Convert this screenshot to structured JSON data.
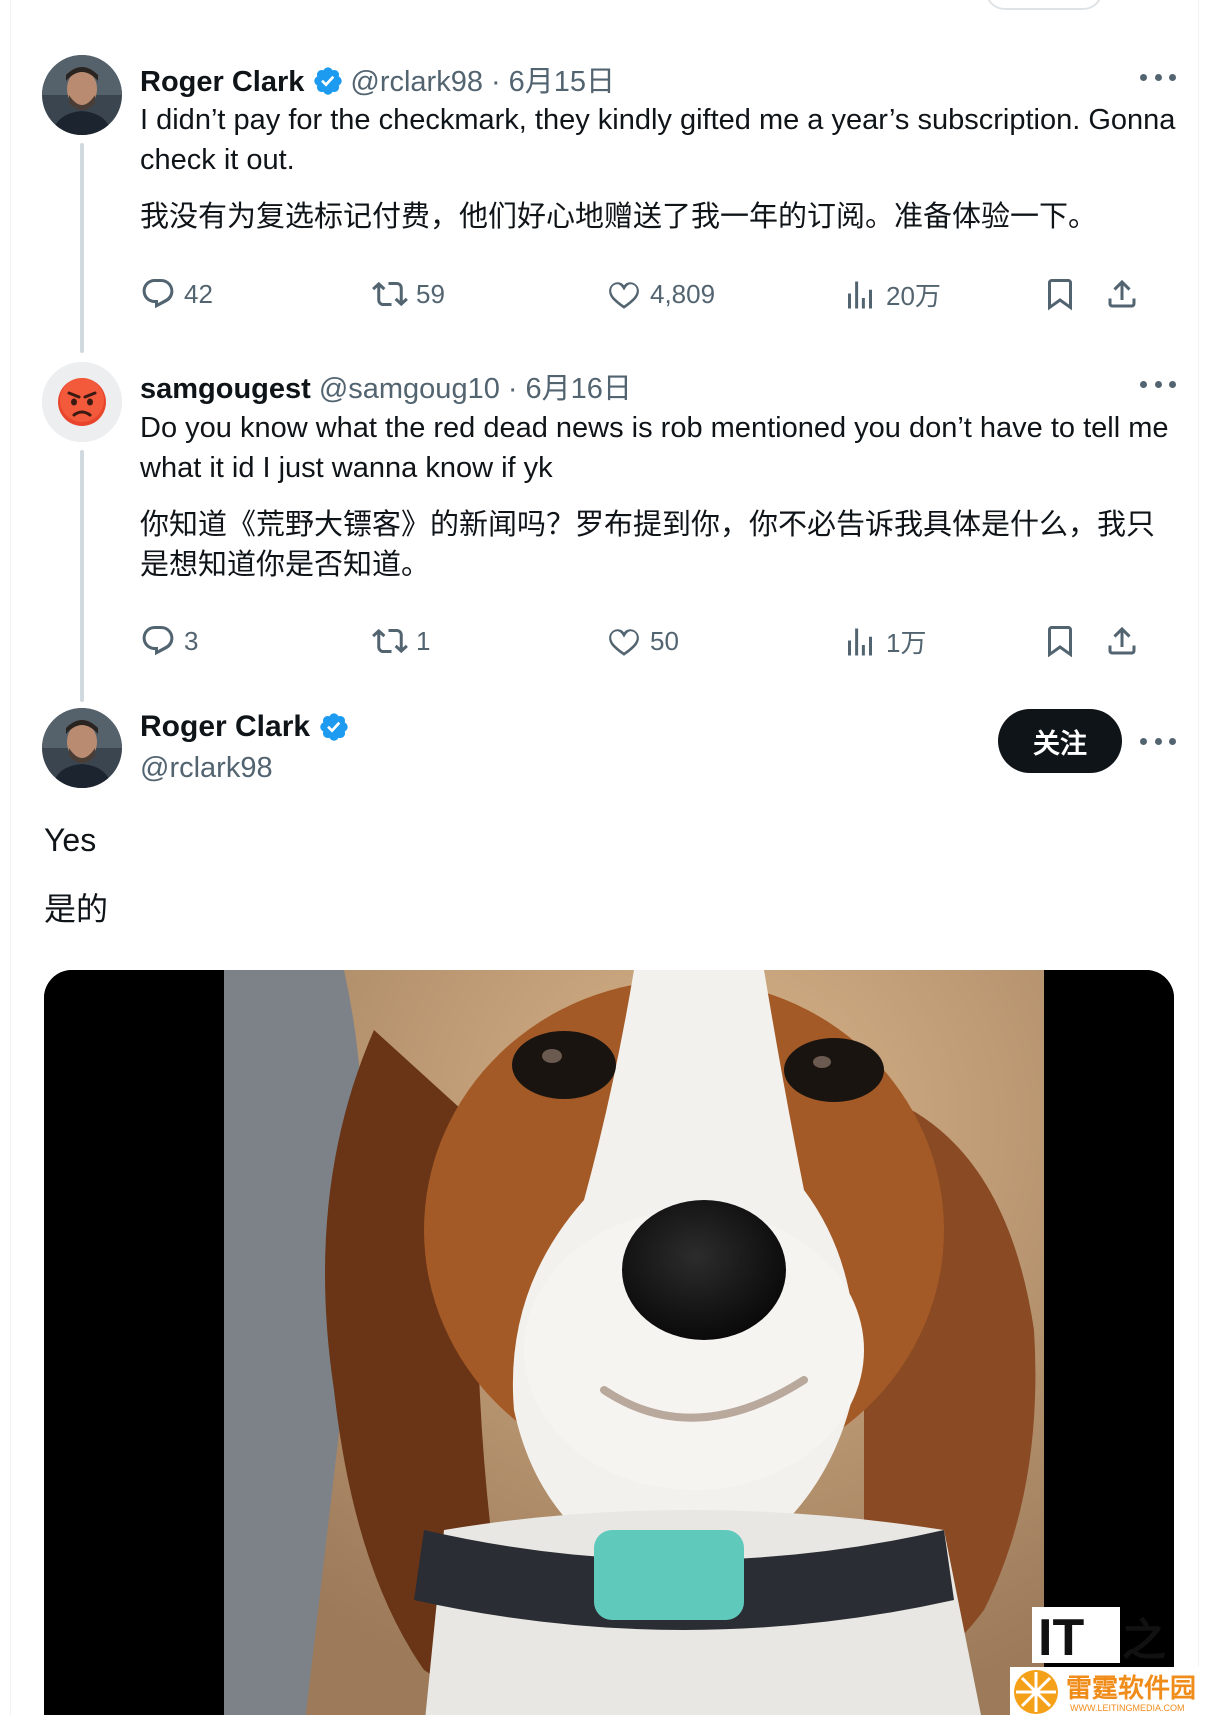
{
  "tweets": [
    {
      "author_name": "Roger Clark",
      "handle": "@rclark98",
      "separator": "·",
      "date": "6月15日",
      "text": "I didn’t pay for the checkmark, they kindly gifted me a year’s subscription. Gonna check it out.",
      "translation": "我没有为复选标记付费，他们好心地赠送了我一年的订阅。准备体验一下。",
      "replies": "42",
      "reposts": "59",
      "likes": "4,809",
      "views": "20万"
    },
    {
      "author_name": "samgougest",
      "handle": "@samgoug10",
      "separator": "·",
      "date": "6月16日",
      "text": "Do you know what the red dead news is rob mentioned you don’t have to tell me what it id I just wanna know if yk",
      "translation": "你知道《荒野大镖客》的新闻吗？罗布提到你，你不必告诉我具体是什么，我只是想知道你是否知道。",
      "replies": "3",
      "reposts": "1",
      "likes": "50",
      "views": "1万"
    }
  ],
  "main_tweet": {
    "author_name": "Roger Clark",
    "handle": "@rclark98",
    "follow_label": "关注",
    "text": "Yes",
    "translation": "是的"
  },
  "watermark": {
    "top_text": "IT",
    "brand_text": "雷霆软件园",
    "url_text": "WWW.LEITINGMEDIA.COM"
  },
  "icons": {
    "verified": "verified-badge-icon",
    "reply": "reply-bubble-icon",
    "repost": "repost-arrows-icon",
    "like": "heart-icon",
    "views": "bar-chart-icon",
    "bookmark": "bookmark-icon",
    "share": "share-upload-icon",
    "more": "more-dots-icon"
  },
  "colors": {
    "verified_blue": "#1d9bf0",
    "text_primary": "#0f1419",
    "text_secondary": "#536471",
    "thread_line": "#cfd9de",
    "follow_button": "#0f1419"
  }
}
